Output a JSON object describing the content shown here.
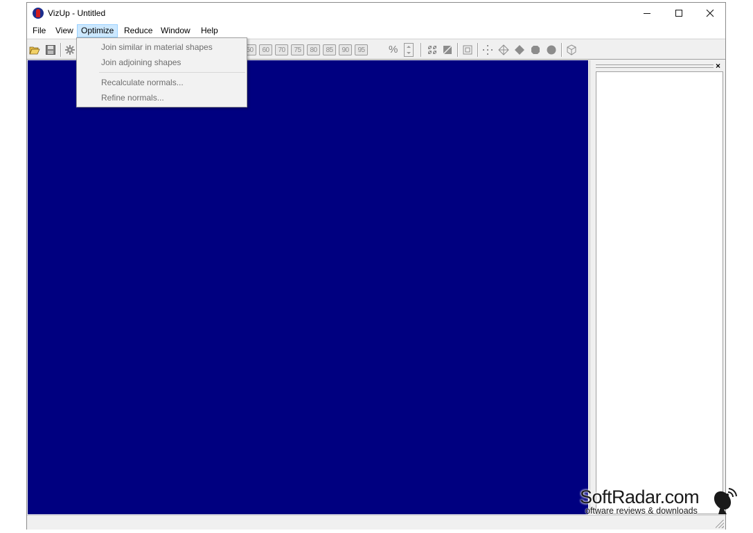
{
  "window": {
    "title": "VizUp - Untitled"
  },
  "menubar": {
    "items": [
      {
        "label": "File"
      },
      {
        "label": "View"
      },
      {
        "label": "Optimize"
      },
      {
        "label": "Reduce"
      },
      {
        "label": "Window"
      },
      {
        "label": "Help"
      }
    ],
    "active_item": "Optimize"
  },
  "optimize_menu": {
    "items": [
      {
        "label": "Join similar in material shapes",
        "enabled": false
      },
      {
        "label": "Join adjoining shapes",
        "enabled": false
      },
      {
        "label": "Recalculate normals...",
        "enabled": false
      },
      {
        "label": "Refine normals...",
        "enabled": false
      }
    ]
  },
  "toolbar": {
    "percent_buttons": [
      "50",
      "60",
      "70",
      "75",
      "80",
      "85",
      "90",
      "95"
    ],
    "percent_sign": "%",
    "icons": [
      "open-folder-icon",
      "save-icon",
      "gear-icon",
      "grid-view-icon",
      "diagonal-view-icon",
      "frame-view-icon",
      "points-icon",
      "vertex-icon",
      "diamond-icon",
      "flat-sphere-icon",
      "smooth-sphere-icon",
      "cube-icon"
    ]
  },
  "viewport": {
    "background_color": "#000080"
  },
  "side_panel": {
    "close_glyph": "×"
  },
  "watermark": {
    "brand": "SoftRadar.com",
    "tagline": "oftware reviews & downloads"
  },
  "colors": {
    "menu_highlight": "#cce8ff",
    "disabled_text": "#6d6d6d",
    "viewport": "#000080",
    "app_icon_red": "#d21c1c",
    "app_icon_blue": "#1c2d8c"
  }
}
